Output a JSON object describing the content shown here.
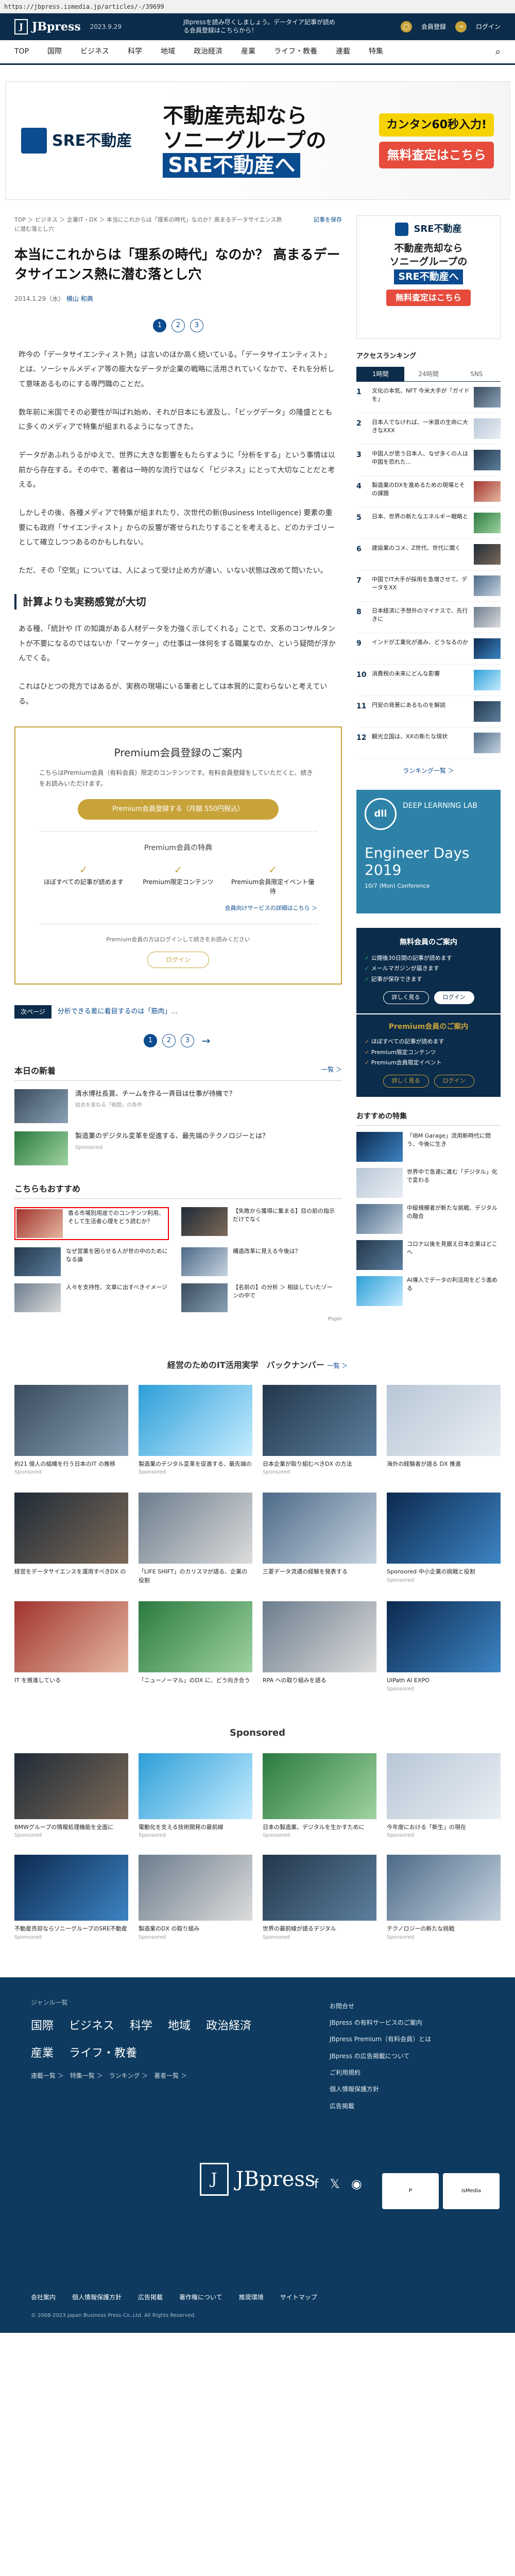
{
  "browser": {
    "url": "https://jbpress.ismedia.jp/articles/-/39699"
  },
  "header": {
    "logo": "JBpress",
    "date": "2023.9.29",
    "message": "JBpressを読み尽くしましょう。データイア記事が読める会員登録はこちらから！",
    "signup": "会員登録",
    "login": "ログイン"
  },
  "nav": [
    "TOP",
    "国際",
    "ビジネス",
    "科学",
    "地域",
    "政治経済",
    "産業",
    "ライフ・教養",
    "連載",
    "特集"
  ],
  "topad": {
    "brand": "SRE不動産",
    "line1": "不動産売却なら",
    "line2": "ソニーグループの",
    "line3": "SRE不動産へ",
    "btn1": "カンタン60秒入力!",
    "btn2": "無料査定はこちら"
  },
  "breadcrumb": "TOP ＞ ビジネス ＞ 企業IT・DX ＞ 本当にこれからは「理系の時代」なのか？高まるデータサイエンス熱に潜む落とし穴",
  "save_label": "記事を保存",
  "article": {
    "title": "本当にこれからは「理系の時代」なのか？ 高まるデータサイエンス熱に潜む落とし穴",
    "date": "2014.1.29（水）",
    "author": "横山 和典",
    "pages": [
      "1",
      "2",
      "3"
    ],
    "paragraphs": [
      "昨今の「データサイエンティスト熱」は言いのほか高く続いている。「データサイエンティスト」とは、ソーシャルメディア等の膨大なデータが企業の戦略に活用されていくなかで、それを分析して意味あるものにする専門職のことだ。",
      "数年前に米国でその必要性が叫ばれ始め、それが日本にも波及し、「ビッグデータ」の隆盛とともに多くのメディアで特集が組まれるようになってきた。",
      "データがあふれうるがゆえで、世界に大きな影響をもたらすように「分析をする」という事情は以前から存在する。その中で、著者は一時的な流行ではなく「ビジネス」にとって大切なことだと考える。",
      "しかしその後、各種メディアで特集が組まれたり、次世代の新(Business Intelligence) 要素の重要にも政府「サイエンティスト」からの反響が寄せられたりすることを考えると、どのカテゴリーとして確立しつつあるのかもしれない。",
      "ただ、その「空気」については、人によって受け止め方が違い、いない状態は改めて問いたい。"
    ],
    "subheading": "計算よりも実務感覚が大切",
    "paragraphs2": [
      "ある種、「統計や IT の知識がある人材データを力強く示してくれる」ことで、文系のコンサルタントが不要になるのではないか「マーケター」の仕事は一体何をする職業なのか、という疑問が浮かんでくる。",
      "これはひとつの見方ではあるが、実務の現場にいる筆者としては本質的に変わらないと考えている。"
    ]
  },
  "premium": {
    "title": "Premium会員登録のご案内",
    "desc": "こちらはPremium会員（有料会員）限定のコンテンツです。有料会員登録をしていただくと、続きをお読みいただけます。",
    "button": "Premium会員登録する（月額 550円税込）",
    "benefits_title": "Premium会員の特典",
    "benefits": [
      "ほぼすべての記事が読めます",
      "Premium限定コンテンツ",
      "Premium会員限定イベント優待"
    ],
    "more": "会員向けサービスの詳細はこちら ＞",
    "already": "Premium会員の方はログインして続きをお読みください",
    "login": "ログイン"
  },
  "nextpage": {
    "label": "次ページ",
    "text": "分析できる差に着目するのは「筋肉」..."
  },
  "latest": {
    "title": "本日の新着",
    "more": "一覧 ＞",
    "items": [
      {
        "title": "清水博社長賞、チームを作る一斉目は仕事が待機で？",
        "sub": "組合を束ねる「戦闘」の条件"
      },
      {
        "title": "製造業のデジタル変革を促進する、最先端のテクノロジーとは？",
        "sub": "Sponsored"
      }
    ]
  },
  "recommend": {
    "title": "こちらもおすすめ",
    "items": [
      "香る市場別用途でのコンテンツ利用、そして生活者心理をどう読むか？",
      "【失敗から獲得に集まる】目の前の指示だけでなく",
      "なぜ営業を困らせる人が世の中のためになる論",
      "構造改革に見える今後は？",
      "人々を支持性、文章に出すべきイメージ",
      "【名前の】の分析 ＞ 相談していたゾーンの中で"
    ],
    "provider": "Popin"
  },
  "sidebar": {
    "ad": {
      "brand": "SRE不動産",
      "line1": "不動産売却なら",
      "line2": "ソニーグループの",
      "line3": "SRE不動産へ",
      "btn": "無料査定はこちら"
    },
    "ranking_title": "アクセスランキング",
    "ranking_tabs": [
      "1時間",
      "24時間",
      "SNS"
    ],
    "ranking": [
      "文化の本気、NFT 今米大手が「ガイドを」",
      "日本人でなければ、一米首の生命に大きなXXX",
      "中国人が思う日本人、なぜ多くの人は中国を恐れた...",
      "製造業のDXを進めるための現場とその課題",
      "日本、世界の新たなエネルギー戦略と",
      "建設業のコメ、Z世代、世代に聞く",
      "中国でIT大手が採用を急増させて、データをXX",
      "日本経済に予想外のマイナスで、先行きに",
      "インドが工業化が進み、どうなるのか",
      "消費税の未来にどんな影響",
      "円安の背景にあるものを解説",
      "観光立国は、XXの新たな現状"
    ],
    "ranking_link": "ランキング一覧 ＞",
    "dll": {
      "tag": "DEEP LEARNING LAB",
      "big": "Engineer Days 2019",
      "small": "10/7 (Mon) Conference"
    },
    "member": {
      "title": "無料会員のご案内",
      "items": [
        "公開後30日間の記事が読めます",
        "メールマガジンが届きます",
        "記事が保存できます"
      ],
      "btns": [
        "詳しく見る",
        "ログイン"
      ]
    },
    "premium": {
      "title": "Premium会員のご案内",
      "items": [
        "ほぼすべての記事が読めます",
        "Premium限定コンテンツ",
        "Premium会員限定イベント"
      ],
      "btns": [
        "詳しく見る",
        "ログイン"
      ]
    },
    "recommend_title": "おすすめの特集",
    "recommend": [
      "「IBM Garage」流用新時代に問う、今後に生き",
      "世界中で急速に進む「デジタル」化で変わる",
      "中級規模者が新たな挑戦、デジタルの融合",
      "コロナ以後を見据え日本企業はどこへ",
      "AI導入でデータの利活用をどう進める"
    ]
  },
  "backnumber": {
    "title": "経営のためのIT活用実学　バックナンバー",
    "more": "一覧 ＞",
    "items": [
      {
        "t": "約21 億人の組織を行う日本のIT の推移",
        "s": "Sponsored"
      },
      {
        "t": "製造業のデジタル変革を促進する、最先端の",
        "s": "Sponsored"
      },
      {
        "t": "日本企業が取り組むべきDX の方法",
        "s": "Sponsored"
      },
      {
        "t": "海外の経験者が語る DX 推進",
        "s": ""
      },
      {
        "t": "経営をデータサイエンスを運用すべきDX の",
        "s": ""
      },
      {
        "t": "「LIFE SHIFT」のカリスマが語る、企業の役割",
        "s": ""
      },
      {
        "t": "三菱データ流通の経験を発表する",
        "s": ""
      },
      {
        "t": "Sponsored 中小企業の挑戦と役割",
        "s": "Sponsored"
      },
      {
        "t": "IT を推進している",
        "s": ""
      },
      {
        "t": "「ニューノーマル」のDX に、どう向き合う",
        "s": ""
      },
      {
        "t": "RPA への取り組みを語る",
        "s": ""
      },
      {
        "t": "UiPath AI EXPO",
        "s": "Sponsored"
      }
    ]
  },
  "sponsored": {
    "title": "Sponsored",
    "items": [
      {
        "t": "BMWグループの情報処理機能を全面に",
        "s": "Sponsored"
      },
      {
        "t": "電動化を支える技術開発の最前線",
        "s": "Sponsored"
      },
      {
        "t": "日本の製造業、デジタルを生かすために",
        "s": "Sponsored"
      },
      {
        "t": "今年度における「新生」の現在",
        "s": "Sponsored"
      },
      {
        "t": "不動産売却ならソニーグループのSRE不動産",
        "s": "Sponsored"
      },
      {
        "t": "製造業のDX の取り組み",
        "s": "Sponsored"
      },
      {
        "t": "世界の最前線が語るデジタル",
        "s": "Sponsored"
      },
      {
        "t": "テクノロジーの新たな挑戦",
        "s": "Sponsored"
      }
    ]
  },
  "footer": {
    "genre_label": "ジャンル一覧",
    "cats": [
      "国際",
      "ビジネス",
      "科学",
      "地域",
      "政治経済",
      "産業",
      "ライフ・教養"
    ],
    "subcats": "連載一覧 ＞　特集一覧 ＞　ランキング ＞　著者一覧 ＞",
    "menu": [
      "お問合せ",
      "JBpress の有料サービスのご案内",
      "JBpress Premium（有料会員）とは",
      "JBpress の広告掲載について",
      "ご利用規約",
      "個人情報保護方針",
      "広告掲載"
    ],
    "logo": "JBpress",
    "links": [
      "会社案内",
      "個人情報保護方針",
      "広告掲載",
      "著作権について",
      "推奨環境",
      "サイトマップ"
    ],
    "copyright": "© 2008-2023 Japan Business Press Co.,Ltd. All Rights Reserved."
  }
}
